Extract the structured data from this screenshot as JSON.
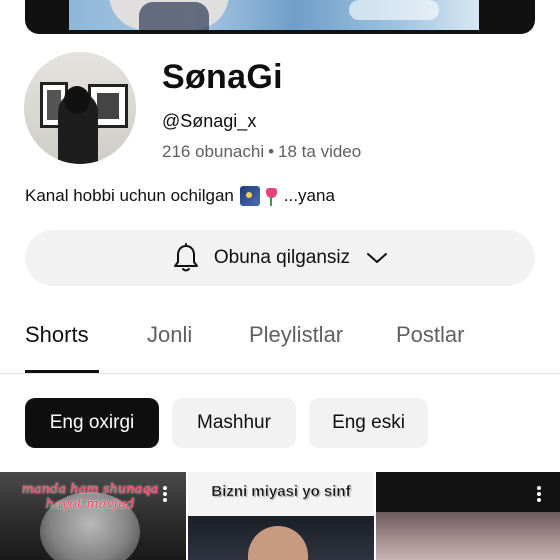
{
  "channel": {
    "name": "SønaGi",
    "handle": "@Sønagi_x",
    "subscribers": "216 obunachi",
    "separator": "•",
    "videos": "18 ta video",
    "description": "Kanal hobbi uchun ochilgan",
    "description_more": "...yana"
  },
  "subscribe": {
    "label": "Obuna qilgansiz",
    "icon": "bell-icon",
    "dropdown_icon": "chevron-down-icon"
  },
  "tabs": [
    {
      "label": "Shorts",
      "active": true
    },
    {
      "label": "Jonli",
      "active": false
    },
    {
      "label": "Pleylistlar",
      "active": false
    },
    {
      "label": "Postlar",
      "active": false
    }
  ],
  "filters": [
    {
      "label": "Eng oxirgi",
      "active": true
    },
    {
      "label": "Mashhur",
      "active": false
    },
    {
      "label": "Eng eski",
      "active": false
    }
  ],
  "shorts": [
    {
      "caption": "manda ham shunaqa hayot mavjud"
    },
    {
      "caption": "Bizni miyasi yo sinf"
    },
    {
      "caption": ""
    }
  ],
  "colors": {
    "accent_dark": "#0f0f0f",
    "chip_bg": "#f2f2f2",
    "secondary_text": "#606060",
    "thumb_caption_pink": "#ff4d6a"
  }
}
